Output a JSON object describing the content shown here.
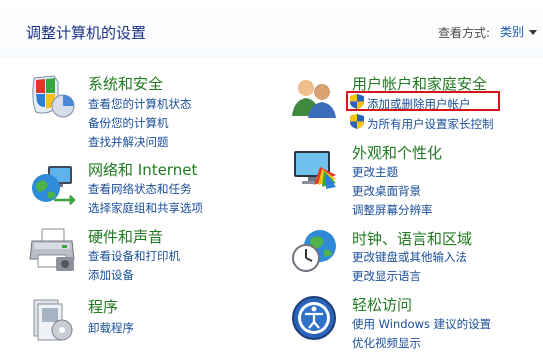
{
  "header": {
    "title": "调整计算机的设置",
    "view_by_label": "查看方式:",
    "view_by_value": "类别"
  },
  "left": {
    "system": {
      "title": "系统和安全",
      "links": [
        "查看您的计算机状态",
        "备份您的计算机",
        "查找并解决问题"
      ]
    },
    "network": {
      "title": "网络和 Internet",
      "links": [
        "查看网络状态和任务",
        "选择家庭组和共享选项"
      ]
    },
    "hardware": {
      "title": "硬件和声音",
      "links": [
        "查看设备和打印机",
        "添加设备"
      ]
    },
    "programs": {
      "title": "程序",
      "links": [
        "卸载程序"
      ]
    }
  },
  "right": {
    "accounts": {
      "title": "用户帐户和家庭安全",
      "links": [
        "添加或删除用户帐户",
        "为所有用户设置家长控制"
      ]
    },
    "appearance": {
      "title": "外观和个性化",
      "links": [
        "更改主题",
        "更改桌面背景",
        "调整屏幕分辨率"
      ]
    },
    "clock": {
      "title": "时钟、语言和区域",
      "links": [
        "更改键盘或其他输入法",
        "更改显示语言"
      ]
    },
    "ease": {
      "title": "轻松访问",
      "links": [
        "使用 Windows 建议的设置",
        "优化视频显示"
      ]
    }
  },
  "colors": {
    "title_blue": "#1e3287",
    "category_green": "#207a20",
    "link_blue": "#1a4f9a",
    "highlight_red": "#d4161c"
  }
}
